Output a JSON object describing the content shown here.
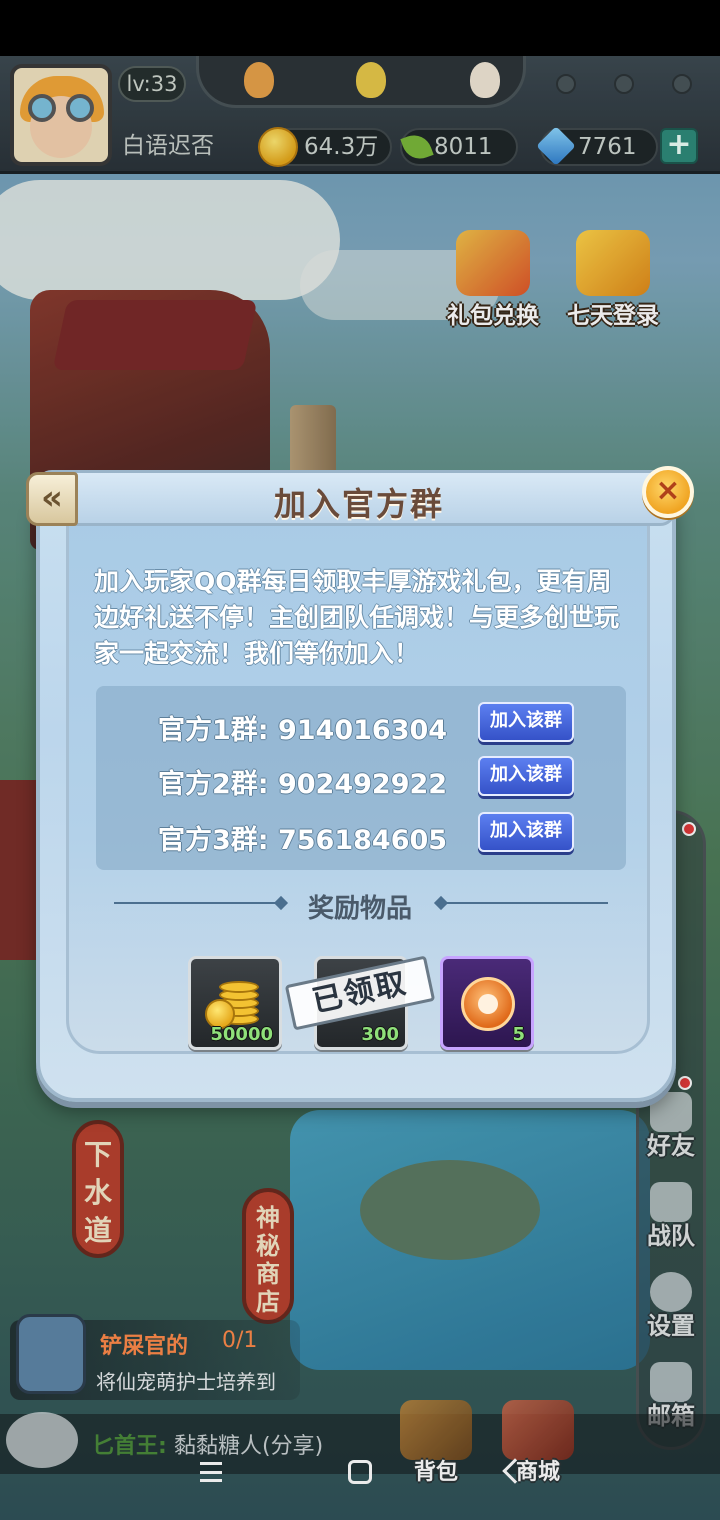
{
  "hud": {
    "level": "lv:33",
    "player_name": "白语迟否",
    "gold": "64.3万",
    "leaves": "8011",
    "gems": "7761",
    "plus_label": "+"
  },
  "events": [
    {
      "label": "礼包兑换",
      "icon": "gift-box-icon"
    },
    {
      "label": "七天登录",
      "icon": "seven-day-icon"
    }
  ],
  "side_menu": [
    {
      "label": "好友",
      "icon": "friends-icon"
    },
    {
      "label": "战队",
      "icon": "team-icon"
    },
    {
      "label": "设置",
      "icon": "gear-icon"
    },
    {
      "label": "邮箱",
      "icon": "mail-icon"
    }
  ],
  "signs": {
    "sewer": "下水道",
    "shop": "神秘商店"
  },
  "quest": {
    "title": "铲屎官的",
    "count": "0/1",
    "desc": "将仙宠萌护士培养到"
  },
  "chat": {
    "speaker": "匕首王:",
    "text": "黏黏糖人(分享)"
  },
  "bottom_buttons": [
    {
      "label": "背包",
      "icon": "backpack-icon"
    },
    {
      "label": "商城",
      "icon": "store-icon"
    }
  ],
  "dialog": {
    "title": "加入官方群",
    "back_icon": "«",
    "close_icon": "×",
    "description": "加入玩家QQ群每日领取丰厚游戏礼包，更有周边好礼送不停！主创团队任调戏！与更多创世玩家一起交流！我们等你加入！",
    "groups": [
      {
        "label": "官方1群: 914016304",
        "button": "加入该群"
      },
      {
        "label": "官方2群: 902492922",
        "button": "加入该群"
      },
      {
        "label": "官方3群: 756184605",
        "button": "加入该群"
      }
    ],
    "reward_title": "奖励物品",
    "rewards": [
      {
        "icon": "gold-coins-icon",
        "count": "50000"
      },
      {
        "icon": "item-icon",
        "count": "300"
      },
      {
        "icon": "pet-medal-icon",
        "count": "5"
      }
    ],
    "claimed_label": "已领取"
  },
  "colors": {
    "dialog_bg": "#bcd6ec",
    "join_button": "#3552c8",
    "close_button": "#f0a422",
    "title_text": "#6a4b3a"
  }
}
